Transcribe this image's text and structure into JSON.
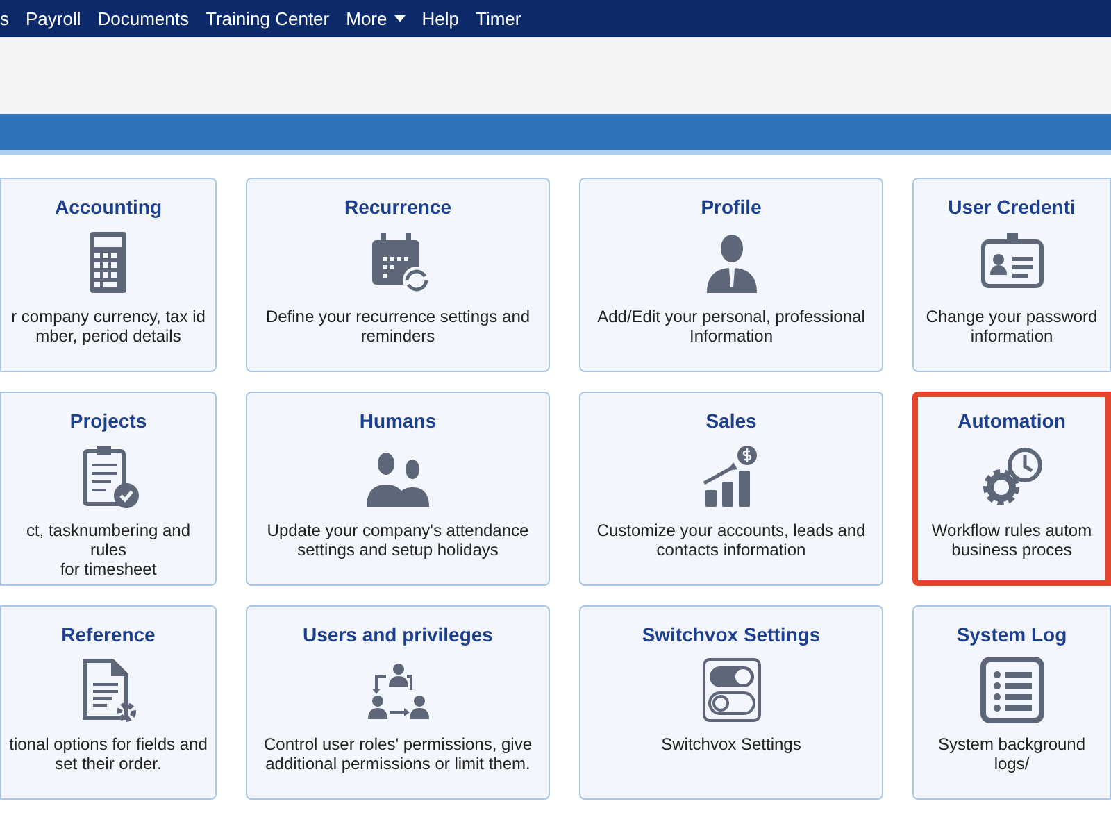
{
  "nav": {
    "items": [
      {
        "label": "s",
        "dropdown": false
      },
      {
        "label": "Payroll",
        "dropdown": false
      },
      {
        "label": "Documents",
        "dropdown": false
      },
      {
        "label": "Training Center",
        "dropdown": false
      },
      {
        "label": "More",
        "dropdown": true
      },
      {
        "label": "Help",
        "dropdown": false
      },
      {
        "label": "Timer",
        "dropdown": false
      }
    ]
  },
  "cards": [
    {
      "title": "Accounting",
      "kind": "calculator",
      "highlighted": false,
      "description": [
        "r company currency, tax id",
        "mber, period details"
      ]
    },
    {
      "title": "Recurrence",
      "kind": "calendar",
      "highlighted": false,
      "description": [
        "Define your recurrence settings and",
        "reminders"
      ]
    },
    {
      "title": "Profile",
      "kind": "person",
      "highlighted": false,
      "description": [
        "Add/Edit your personal, professional",
        "Information"
      ]
    },
    {
      "title": "User Credenti",
      "kind": "id-card",
      "highlighted": false,
      "description": [
        "Change your password",
        "information"
      ]
    },
    {
      "title": "Projects",
      "kind": "clipboard",
      "highlighted": false,
      "description": [
        "ct, tasknumbering and rules",
        "for timesheet"
      ]
    },
    {
      "title": "Humans",
      "kind": "people",
      "highlighted": false,
      "description": [
        "Update your company's attendance",
        "settings and setup holidays"
      ]
    },
    {
      "title": "Sales",
      "kind": "growth",
      "highlighted": false,
      "description": [
        "Customize your accounts, leads and",
        "contacts information"
      ]
    },
    {
      "title": "Automation",
      "kind": "gear-clock",
      "highlighted": true,
      "description": [
        "Workflow rules autom",
        "business proces"
      ]
    },
    {
      "title": "Reference",
      "kind": "document",
      "highlighted": false,
      "description": [
        "tional options for fields and",
        "set their order."
      ]
    },
    {
      "title": "Users and privileges",
      "kind": "user-flow",
      "highlighted": false,
      "description": [
        "Control user roles' permissions, give",
        "additional permissions or limit them."
      ]
    },
    {
      "title": "Switchvox Settings",
      "kind": "toggles",
      "highlighted": false,
      "description": [
        "Switchvox Settings"
      ]
    },
    {
      "title": "System Log",
      "kind": "list",
      "highlighted": false,
      "description": [
        "System background logs/"
      ]
    }
  ]
}
